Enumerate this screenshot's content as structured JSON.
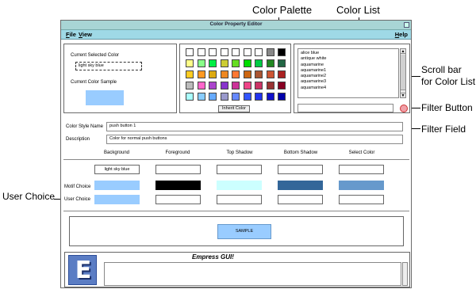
{
  "window": {
    "title": "Color Property Editor",
    "menu": {
      "file": "File",
      "view": "View",
      "help": "Help"
    }
  },
  "current_color_panel": {
    "selected_label": "Current Selected Color",
    "selected_value": "light sky blue",
    "sample_label": "Current Color Sample",
    "sample_color": "#99ccff"
  },
  "palette": {
    "rows": [
      [
        "#ffffff",
        "#ffffff",
        "#ffffff",
        "#ffffff",
        "#ffffff",
        "#ffffff",
        "#ffffff",
        "#888888",
        "#000000"
      ],
      [
        "#ffff88",
        "#88ff88",
        "#00ee44",
        "#cccc33",
        "#66dd22",
        "#00dd00",
        "#00cc44",
        "#228822",
        "#226644"
      ],
      [
        "#ffcc22",
        "#ff9922",
        "#ddaa11",
        "#ee8822",
        "#ff7733",
        "#cc6611",
        "#aa5533",
        "#cc5533",
        "#aa2222"
      ],
      [
        "#bbbbbb",
        "#ff66cc",
        "#aa44cc",
        "#8833cc",
        "#cc3399",
        "#ee4488",
        "#cc3366",
        "#993333",
        "#880022"
      ],
      [
        "#aaffff",
        "#88ccff",
        "#66aaff",
        "#9999cc",
        "#6688ff",
        "#3355ff",
        "#2233ee",
        "#1111cc",
        "#0000aa"
      ]
    ],
    "inherit_button": "Inherit Color"
  },
  "color_list": {
    "items": [
      "alice blue",
      "antique white",
      "aquamarine",
      "aquamarine1",
      "aquamarine2",
      "aquamarine3",
      "aquamarine4"
    ],
    "filter_value": ""
  },
  "style": {
    "name_label": "Color Style Name",
    "name_value": "push button 1",
    "desc_label": "Description",
    "desc_value": "Color for normal push buttons"
  },
  "columns": [
    "Background",
    "Foreground",
    "Top Shadow",
    "Bottom Shadow",
    "Select Color"
  ],
  "names_row": {
    "background": "light sky blue"
  },
  "motif_choice": {
    "label": "Motif Choice",
    "colors": [
      "#99ccff",
      "#000000",
      "#ccffff",
      "#336699",
      "#6699cc"
    ]
  },
  "user_choice": {
    "label": "User Choice",
    "colors": [
      "#99ccff",
      "#ffffff",
      "#ffffff",
      "#ffffff",
      "#ffffff"
    ]
  },
  "sample_button": {
    "label": "SAMPLE",
    "color": "#99ccff"
  },
  "footer": {
    "title": "Empress GUI!",
    "logo_letter": "E"
  },
  "callouts": {
    "color_palette": "Color Palette",
    "color_list": "Color List",
    "scroll_bar_1": "Scroll bar",
    "scroll_bar_2": "for Color List",
    "filter_button": "Filter Button",
    "filter_field": "Filter Field",
    "user_choice": "User Choice"
  }
}
